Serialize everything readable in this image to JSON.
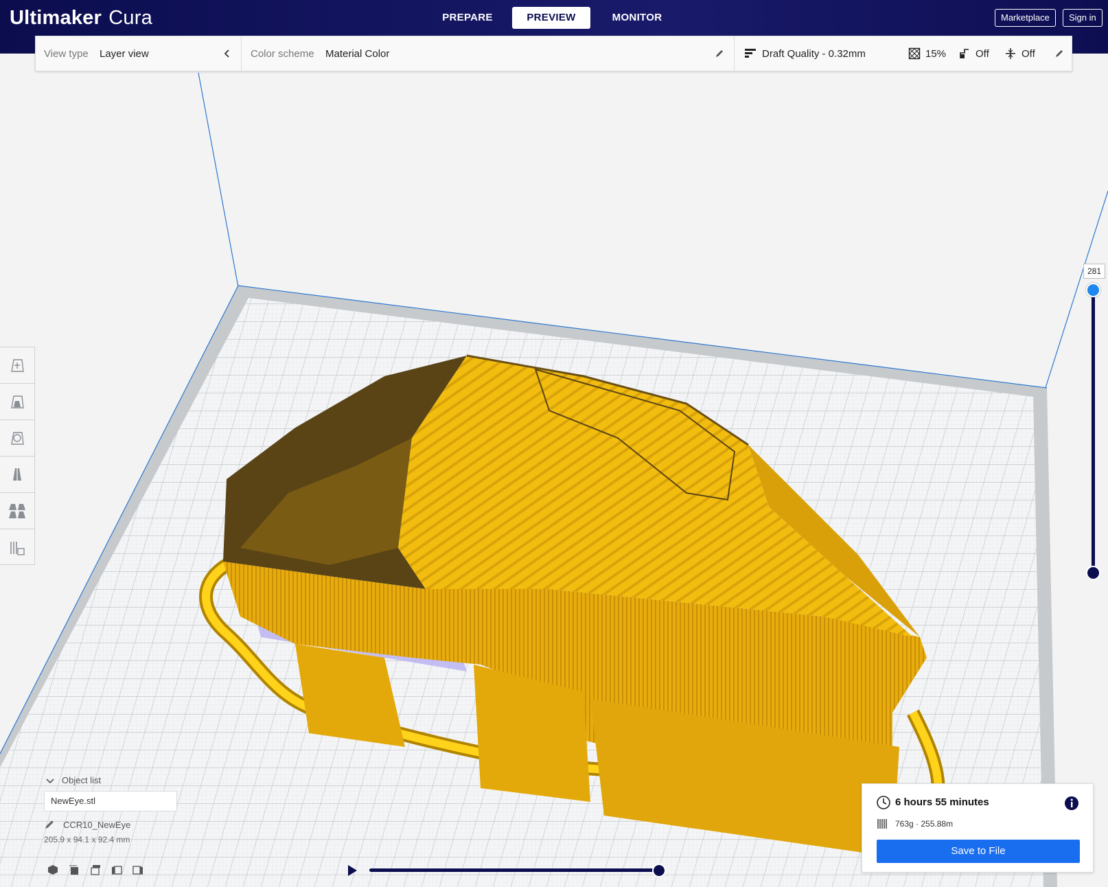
{
  "app": {
    "brand": "Ultimaker",
    "product": "Cura"
  },
  "stages": [
    {
      "label": "PREPARE",
      "active": false
    },
    {
      "label": "PREVIEW",
      "active": true
    },
    {
      "label": "MONITOR",
      "active": false
    }
  ],
  "header_buttons": {
    "marketplace": "Marketplace",
    "sign_in": "Sign in"
  },
  "view_settings": {
    "view_type_label": "View type",
    "view_type_value": "Layer view",
    "color_scheme_label": "Color scheme",
    "color_scheme_value": "Material Color"
  },
  "print_settings": {
    "quality": "Draft Quality - 0.32mm",
    "infill": "15%",
    "support": "Off",
    "adhesion": "Off"
  },
  "layer_slider": {
    "current_layer": "281"
  },
  "object_list": {
    "header": "Object list",
    "file": "NewEye.stl",
    "machine": "CCR10_NewEye",
    "dimensions": "205.9 x 94.1 x 92.4 mm"
  },
  "print_info": {
    "time": "6 hours 55 minutes",
    "material": "763g · 255.88m",
    "save_label": "Save to File"
  },
  "colors": {
    "header": "#0b0d4f",
    "accent_blue": "#196ef0",
    "model_yellow": "#f2bd0f",
    "model_shadow": "#5a4416"
  },
  "icons": {
    "tools": [
      "move-icon",
      "scale-icon",
      "rotate-icon",
      "mirror-icon",
      "per-model-settings-icon",
      "support-blocker-icon"
    ],
    "views": [
      "3d-view-icon",
      "front-view-icon",
      "top-view-icon",
      "left-view-icon",
      "right-view-icon"
    ]
  }
}
